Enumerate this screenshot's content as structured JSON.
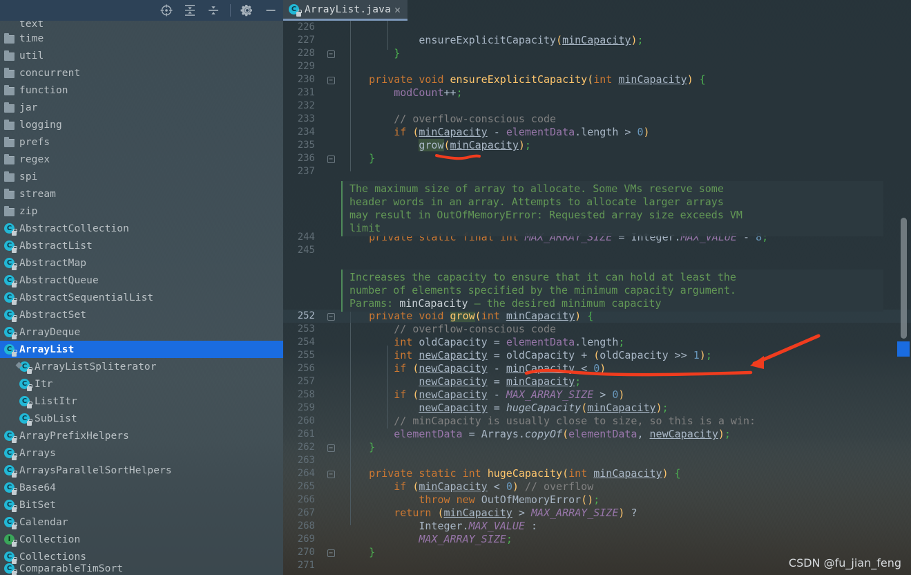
{
  "toolbar": {
    "icons": [
      {
        "name": "locate-icon",
        "label": "Select Opened File"
      },
      {
        "name": "expand-all-icon",
        "label": "Expand All"
      },
      {
        "name": "collapse-all-icon",
        "label": "Collapse All"
      },
      {
        "name": "gear-icon",
        "label": "Settings"
      },
      {
        "name": "minimize-icon",
        "label": "Hide"
      }
    ]
  },
  "sidebar": {
    "items": [
      {
        "label": "text",
        "icon": "folder-icon",
        "indent": 0,
        "clipped": true,
        "selected": false
      },
      {
        "label": "time",
        "icon": "folder-icon",
        "indent": 0,
        "clipped": false,
        "selected": false
      },
      {
        "label": "util",
        "icon": "folder-icon",
        "indent": 0,
        "clipped": false,
        "selected": false
      },
      {
        "label": "concurrent",
        "icon": "folder-icon",
        "indent": 0,
        "selected": false
      },
      {
        "label": "function",
        "icon": "folder-icon",
        "indent": 0,
        "selected": false
      },
      {
        "label": "jar",
        "icon": "folder-icon",
        "indent": 0,
        "selected": false
      },
      {
        "label": "logging",
        "icon": "folder-icon",
        "indent": 0,
        "selected": false
      },
      {
        "label": "prefs",
        "icon": "folder-icon",
        "indent": 0,
        "selected": false
      },
      {
        "label": "regex",
        "icon": "folder-icon",
        "indent": 0,
        "selected": false
      },
      {
        "label": "spi",
        "icon": "folder-icon",
        "indent": 0,
        "selected": false
      },
      {
        "label": "stream",
        "icon": "folder-icon",
        "indent": 0,
        "selected": false
      },
      {
        "label": "zip",
        "icon": "folder-icon",
        "indent": 0,
        "selected": false
      },
      {
        "label": "AbstractCollection",
        "icon": "class-icon",
        "indent": 0,
        "selected": false
      },
      {
        "label": "AbstractList",
        "icon": "class-icon",
        "indent": 0,
        "selected": false
      },
      {
        "label": "AbstractMap",
        "icon": "class-icon",
        "indent": 0,
        "selected": false
      },
      {
        "label": "AbstractQueue",
        "icon": "class-icon",
        "indent": 0,
        "selected": false
      },
      {
        "label": "AbstractSequentialList",
        "icon": "class-icon",
        "indent": 0,
        "selected": false
      },
      {
        "label": "AbstractSet",
        "icon": "class-icon",
        "indent": 0,
        "selected": false
      },
      {
        "label": "ArrayDeque",
        "icon": "class-icon",
        "indent": 0,
        "selected": false
      },
      {
        "label": "ArrayList",
        "icon": "class-icon",
        "indent": 0,
        "selected": true
      },
      {
        "label": "ArrayListSpliterator",
        "icon": "inner-class-icon",
        "indent": 1,
        "selected": false
      },
      {
        "label": "Itr",
        "icon": "class-icon",
        "indent": 1,
        "selected": false
      },
      {
        "label": "ListItr",
        "icon": "class-icon",
        "indent": 1,
        "selected": false
      },
      {
        "label": "SubList",
        "icon": "class-icon",
        "indent": 1,
        "selected": false
      },
      {
        "label": "ArrayPrefixHelpers",
        "icon": "class-icon",
        "indent": 0,
        "selected": false
      },
      {
        "label": "Arrays",
        "icon": "class-icon",
        "indent": 0,
        "selected": false
      },
      {
        "label": "ArraysParallelSortHelpers",
        "icon": "class-icon",
        "indent": 0,
        "selected": false
      },
      {
        "label": "Base64",
        "icon": "class-icon",
        "indent": 0,
        "selected": false
      },
      {
        "label": "BitSet",
        "icon": "class-icon",
        "indent": 0,
        "selected": false
      },
      {
        "label": "Calendar",
        "icon": "class-icon",
        "indent": 0,
        "selected": false
      },
      {
        "label": "Collection",
        "icon": "interface-icon",
        "indent": 0,
        "selected": false
      },
      {
        "label": "Collections",
        "icon": "class-icon",
        "indent": 0,
        "selected": false
      },
      {
        "label": "ComparableTimSort",
        "icon": "class-icon",
        "indent": 0,
        "clipped": true,
        "selected": false
      }
    ]
  },
  "editor": {
    "tab": {
      "label": "ArrayList.java",
      "icon": "java-class-icon",
      "close": "✕"
    },
    "caret_line": 252,
    "lines": [
      {
        "n": "226",
        "fold": "",
        "text": ""
      },
      {
        "n": "227",
        "fold": "",
        "text": "            ensureExplicitCapacity(minCapacity);"
      },
      {
        "n": "228",
        "fold": "-",
        "text": "        }"
      },
      {
        "n": "229",
        "fold": "",
        "text": ""
      },
      {
        "n": "230",
        "fold": "-",
        "text": "    private void ensureExplicitCapacity(int minCapacity) {"
      },
      {
        "n": "231",
        "fold": "",
        "text": "        modCount++;"
      },
      {
        "n": "232",
        "fold": "",
        "text": ""
      },
      {
        "n": "233",
        "fold": "",
        "text": "        // overflow-conscious code"
      },
      {
        "n": "234",
        "fold": "",
        "text": "        if (minCapacity - elementData.length > 0)"
      },
      {
        "n": "235",
        "fold": "",
        "text": "            grow(minCapacity);"
      },
      {
        "n": "236",
        "fold": "-",
        "text": "    }"
      },
      {
        "n": "237",
        "fold": "",
        "text": ""
      },
      {
        "n": "",
        "fold": "",
        "text": ""
      },
      {
        "n": "",
        "fold": "",
        "text": ""
      },
      {
        "n": "",
        "fold": "",
        "text": ""
      },
      {
        "n": "",
        "fold": "",
        "text": ""
      },
      {
        "n": "244",
        "fold": "",
        "text": "    private static final int MAX_ARRAY_SIZE = Integer.MAX_VALUE - 8;"
      },
      {
        "n": "245",
        "fold": "",
        "text": ""
      },
      {
        "n": "",
        "fold": "",
        "text": ""
      },
      {
        "n": "",
        "fold": "",
        "text": ""
      },
      {
        "n": "",
        "fold": "",
        "text": ""
      },
      {
        "n": "",
        "fold": "",
        "text": ""
      },
      {
        "n": "252",
        "fold": "-",
        "text": "    private void grow(int minCapacity) {"
      },
      {
        "n": "253",
        "fold": "",
        "text": "        // overflow-conscious code"
      },
      {
        "n": "254",
        "fold": "",
        "text": "        int oldCapacity = elementData.length;"
      },
      {
        "n": "255",
        "fold": "",
        "text": "        int newCapacity = oldCapacity + (oldCapacity >> 1);"
      },
      {
        "n": "256",
        "fold": "",
        "text": "        if (newCapacity - minCapacity < 0)"
      },
      {
        "n": "257",
        "fold": "",
        "text": "            newCapacity = minCapacity;"
      },
      {
        "n": "258",
        "fold": "",
        "text": "        if (newCapacity - MAX_ARRAY_SIZE > 0)"
      },
      {
        "n": "259",
        "fold": "",
        "text": "            newCapacity = hugeCapacity(minCapacity);"
      },
      {
        "n": "260",
        "fold": "",
        "text": "        // minCapacity is usually close to size, so this is a win:"
      },
      {
        "n": "261",
        "fold": "",
        "text": "        elementData = Arrays.copyOf(elementData, newCapacity);"
      },
      {
        "n": "262",
        "fold": "-",
        "text": "    }"
      },
      {
        "n": "263",
        "fold": "",
        "text": ""
      },
      {
        "n": "264",
        "fold": "-",
        "text": "    private static int hugeCapacity(int minCapacity) {"
      },
      {
        "n": "265",
        "fold": "",
        "text": "        if (minCapacity < 0) // overflow"
      },
      {
        "n": "266",
        "fold": "",
        "text": "            throw new OutOfMemoryError();"
      },
      {
        "n": "267",
        "fold": "",
        "text": "        return (minCapacity > MAX_ARRAY_SIZE) ?"
      },
      {
        "n": "268",
        "fold": "",
        "text": "            Integer.MAX_VALUE :"
      },
      {
        "n": "269",
        "fold": "",
        "text": "            MAX_ARRAY_SIZE;"
      },
      {
        "n": "270",
        "fold": "-",
        "text": "    }"
      },
      {
        "n": "271",
        "fold": "",
        "text": ""
      }
    ],
    "doc_blocks": [
      {
        "name": "max-array-size-doc",
        "text": "The maximum size of array to allocate. Some VMs reserve some\nheader words in an array. Attempts to allocate larger arrays\nmay result in OutOfMemoryError: Requested array size exceeds VM\nlimit"
      },
      {
        "name": "grow-doc",
        "line1": "Increases the capacity to ensure that it can hold at least the",
        "line2": "number of elements specified by the minimum capacity argument.",
        "params_label": "Params:",
        "params_name": "minCapacity",
        "params_desc": "– the desired minimum capacity"
      }
    ]
  },
  "annotations": {
    "underline_grow": "red-underline-grow",
    "underline_newcapacity": "red-underline-newcapacity",
    "arrow": "red-arrow-pointing-left",
    "color": "#f03c1e"
  },
  "watermark": {
    "text": "CSDN @fu_jian_feng"
  }
}
